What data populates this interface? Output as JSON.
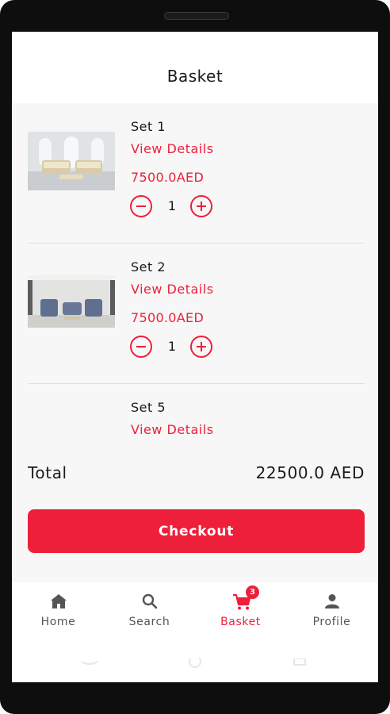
{
  "header": {
    "title": "Basket"
  },
  "basket": {
    "items": [
      {
        "name": "Set 1",
        "details_label": "View Details",
        "price": "7500.0AED",
        "quantity": "1"
      },
      {
        "name": "Set 2",
        "details_label": "View Details",
        "price": "7500.0AED",
        "quantity": "1"
      },
      {
        "name": "Set 5",
        "details_label": "View Details",
        "price": "",
        "quantity": ""
      }
    ]
  },
  "summary": {
    "total_label": "Total",
    "total_value": "22500.0 AED"
  },
  "checkout": {
    "label": "Checkout"
  },
  "nav": {
    "items": [
      {
        "label": "Home",
        "icon": "home-icon"
      },
      {
        "label": "Search",
        "icon": "search-icon"
      },
      {
        "label": "Basket",
        "icon": "cart-icon",
        "badge": "3"
      },
      {
        "label": "Profile",
        "icon": "person-icon"
      }
    ]
  },
  "colors": {
    "accent": "#ee1f3a",
    "text": "#1a1a1a",
    "background": "#f7f7f7"
  }
}
